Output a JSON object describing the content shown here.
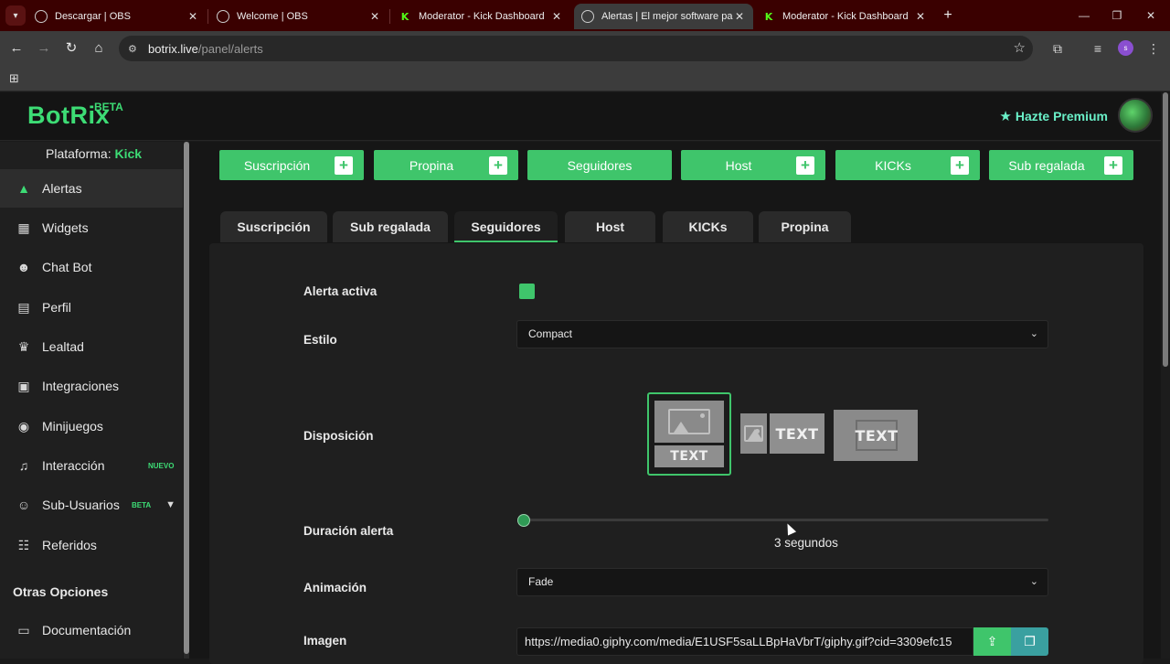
{
  "browser": {
    "tabs": [
      {
        "title": "Descargar | OBS",
        "icon": "globe-icon",
        "active": false
      },
      {
        "title": "Welcome | OBS",
        "icon": "globe-icon",
        "active": false
      },
      {
        "title": "Moderator - Kick Dashboard",
        "icon": "kick-icon",
        "active": false
      },
      {
        "title": "Alertas | El mejor software para",
        "icon": "botrix-icon",
        "active": true
      },
      {
        "title": "Moderator - Kick Dashboard",
        "icon": "kick-icon",
        "active": false
      }
    ],
    "url_host": "botrix.live",
    "url_path": "/panel/alerts",
    "profile_initial": "s",
    "tab_close_glyph": "✕",
    "kick_glyph": "K"
  },
  "header": {
    "logo": "BotRix",
    "logo_badge": "BETA",
    "premium_label": "Hazte Premium"
  },
  "sidebar": {
    "platform_label": "Plataforma:",
    "platform_value": "Kick",
    "items": [
      {
        "label": "Alertas",
        "icon": "alert-triangle-icon",
        "active": true
      },
      {
        "label": "Widgets",
        "icon": "grid-icon",
        "active": false
      },
      {
        "label": "Chat Bot",
        "icon": "robot-icon",
        "active": false
      },
      {
        "label": "Perfil",
        "icon": "id-card-icon",
        "active": false
      },
      {
        "label": "Lealtad",
        "icon": "trophy-icon",
        "active": false
      },
      {
        "label": "Integraciones",
        "icon": "integrations-icon",
        "active": false
      },
      {
        "label": "Minijuegos",
        "icon": "gamepad-icon",
        "active": false
      },
      {
        "label": "Interacción",
        "icon": "music-icon",
        "active": false,
        "badge": "NUEVO"
      },
      {
        "label": "Sub-Usuarios",
        "icon": "users-icon",
        "active": false,
        "badge": "BETA"
      },
      {
        "label": "Referidos",
        "icon": "referral-icon",
        "active": false
      }
    ],
    "section_heading": "Otras Opciones",
    "extra_items": [
      {
        "label": "Documentación",
        "icon": "book-icon"
      }
    ]
  },
  "add_buttons": [
    {
      "label": "Suscripción",
      "has_plus": true
    },
    {
      "label": "Propina",
      "has_plus": true
    },
    {
      "label": "Seguidores",
      "has_plus": false
    },
    {
      "label": "Host",
      "has_plus": true
    },
    {
      "label": "KICKs",
      "has_plus": true
    },
    {
      "label": "Sub regalada",
      "has_plus": true
    }
  ],
  "content_tabs": [
    {
      "label": "Suscripción",
      "active": false
    },
    {
      "label": "Sub regalada",
      "active": false
    },
    {
      "label": "Seguidores",
      "active": true
    },
    {
      "label": "Host",
      "active": false
    },
    {
      "label": "KICKs",
      "active": false
    },
    {
      "label": "Propina",
      "active": false
    }
  ],
  "form": {
    "active_label": "Alerta activa",
    "active_value": true,
    "style_label": "Estilo",
    "style_value": "Compact",
    "layout_label": "Disposición",
    "layout_text": "TEXT",
    "layout_selected": 0,
    "duration_label": "Duración alerta",
    "duration_value": "3",
    "duration_unit": "segundos",
    "animation_label": "Animación",
    "animation_value": "Fade",
    "image_label": "Imagen",
    "image_value": "https://media0.giphy.com/media/E1USF5saLLBpHaVbrT/giphy.gif?cid=3309efc15"
  },
  "colors": {
    "accent": "#3fc56b",
    "brand": "#3ddc75",
    "premium": "#6af0c8",
    "kick": "#53fc18"
  }
}
